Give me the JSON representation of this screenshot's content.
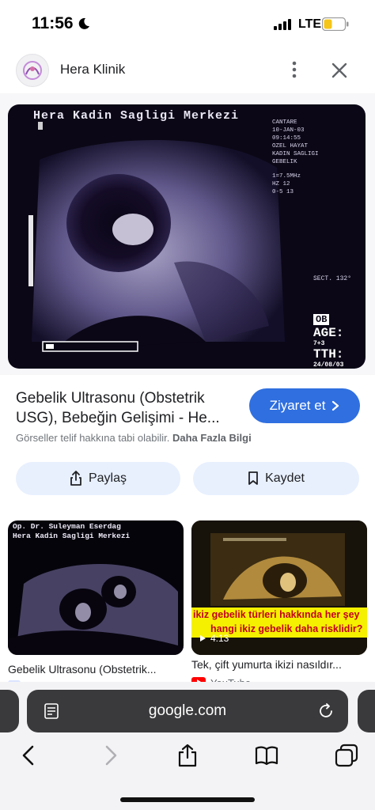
{
  "status_bar": {
    "time": "11:56",
    "network": "LTE"
  },
  "header": {
    "site_name": "Hera Klinik"
  },
  "image": {
    "overlay_title": "Hera Kadin Sagligi Merkezi",
    "right_text": [
      "CANTARE",
      "10-JAN-03",
      "09:14:55",
      "OZEL HAYAT",
      "KADIN SAGLIGI",
      "GEBELIK",
      "1=7.5MHz",
      "HZ  12",
      "0-5  13"
    ],
    "sect": "SECT. 132°",
    "age_label": "AGE:",
    "age_value": "7+3",
    "tth_label": "TTH:",
    "tth_value": "24/08/03",
    "scan_tag": "OB"
  },
  "result": {
    "title": "Gebelik Ultrasonu (Obstetrik USG), Bebeğin Gelişimi - He...",
    "visit_label": "Ziyaret et",
    "copyright": "Görseller telif hakkına tabi olabilir.",
    "more_info": "Daha Fazla Bilgi",
    "share_label": "Paylaş",
    "save_label": "Kaydet"
  },
  "related": [
    {
      "overlay_line1": "Op. Dr. Suleyman Eserdag",
      "overlay_line2": "Hera Kadin Sagligi Merkezi",
      "caption": "Gebelik Ultrasonu (Obstetrik..."
    },
    {
      "banner_line1": "ikiz gebelik türleri hakkında her şey",
      "banner_line2": "hangi ikiz gebelik daha risklidir?",
      "duration": "4:13",
      "caption": "Tek, çift yumurta ikizi nasıldır...",
      "source": "YouTube"
    }
  ],
  "browser": {
    "url": "google.com"
  },
  "icons": [
    "moon-icon",
    "signal-icon",
    "battery-icon",
    "more-icon",
    "close-icon",
    "lens-icon",
    "chevron-right-icon",
    "share-icon",
    "bookmark-icon",
    "play-icon",
    "youtube-icon",
    "reader-icon",
    "reload-icon",
    "back-icon",
    "forward-icon",
    "share-toolbar-icon",
    "bookmarks-icon",
    "tabs-icon"
  ],
  "colors": {
    "primary_button": "#2f6fe0",
    "pill_bg": "#e8f0fe",
    "youtube_red": "#ff0000",
    "battery_fill": "#f5c518"
  }
}
